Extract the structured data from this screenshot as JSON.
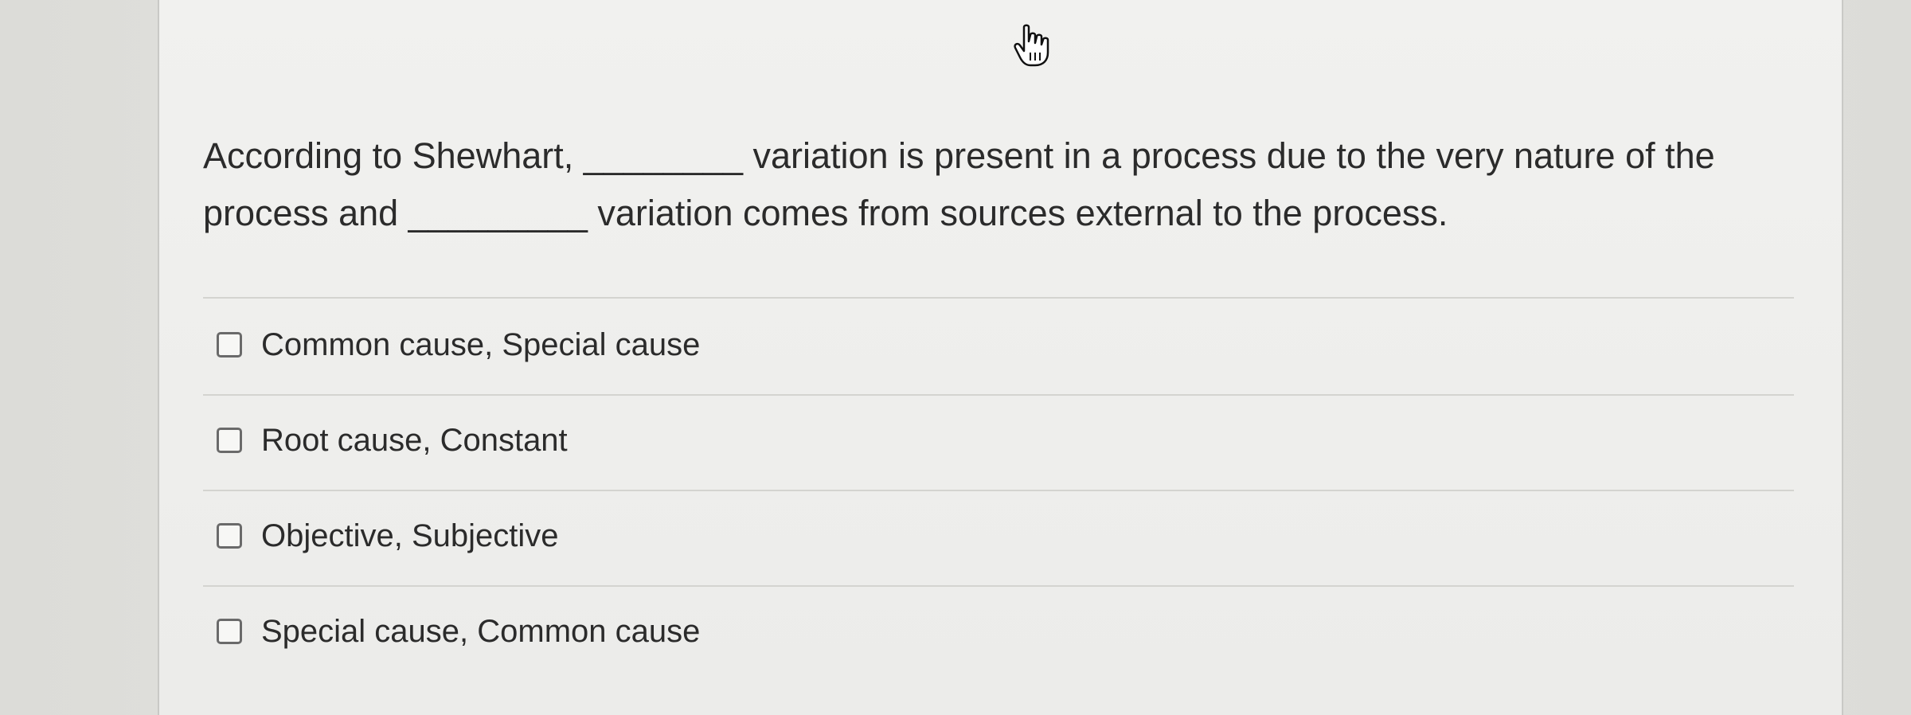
{
  "question": {
    "text": "According to Shewhart, ________ variation is present in a process due to the very nature of the process and _________ variation comes from sources external to the process."
  },
  "options": [
    {
      "label": "Common cause, Special cause",
      "checked": false
    },
    {
      "label": "Root cause, Constant",
      "checked": false
    },
    {
      "label": "Objective, Subjective",
      "checked": false
    },
    {
      "label": "Special cause, Common cause",
      "checked": false
    }
  ],
  "cursor": {
    "icon": "hand-pointer-icon"
  }
}
